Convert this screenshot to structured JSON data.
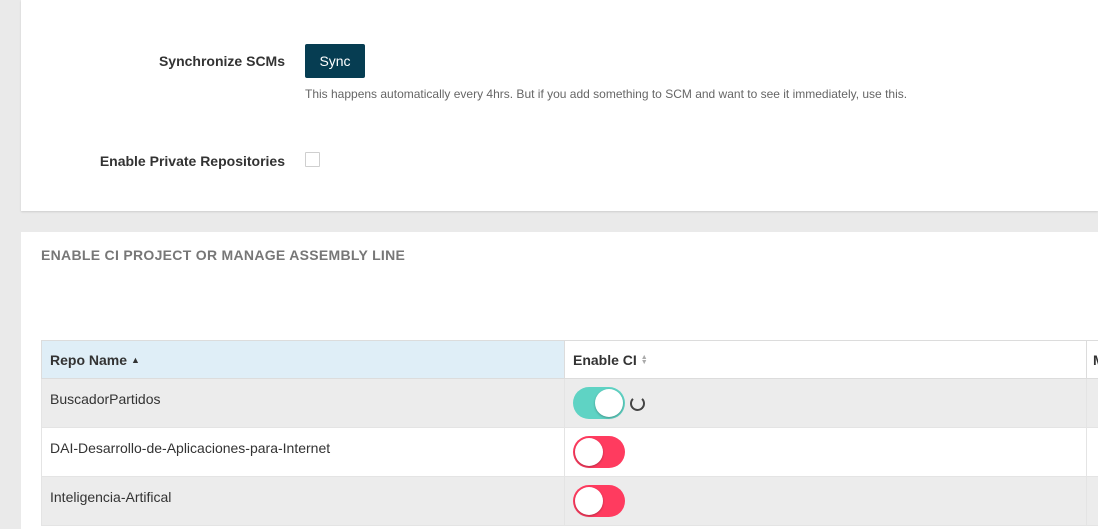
{
  "settings": {
    "sync_label": "Synchronize SCMs",
    "sync_button": "Sync",
    "sync_help": "This happens automatically every 4hrs. But if you add something to SCM and want to see it immediately, use this.",
    "private_label": "Enable Private Repositories",
    "private_checked": false
  },
  "ci_section": {
    "title": "ENABLE CI PROJECT OR MANAGE ASSEMBLY LINE",
    "columns": {
      "repo_name": "Repo Name",
      "enable_ci": "Enable CI",
      "more": "M"
    },
    "rows": [
      {
        "name": "BuscadorPartidos",
        "ci_enabled": true,
        "loading": true
      },
      {
        "name": "DAI-Desarrollo-de-Aplicaciones-para-Internet",
        "ci_enabled": false,
        "loading": false
      },
      {
        "name": "Inteligencia-Artifical",
        "ci_enabled": false,
        "loading": false
      }
    ]
  },
  "colors": {
    "sync_button": "#063d52",
    "toggle_on": "#5fd3c4",
    "toggle_off": "#ff3b5f",
    "header_sorted": "#dfeef7"
  }
}
